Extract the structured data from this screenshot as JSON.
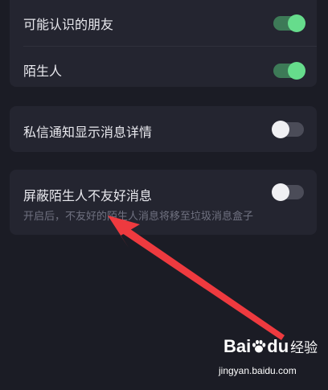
{
  "settings": {
    "group1": {
      "items": [
        {
          "label": "可能认识的朋友",
          "enabled": true
        },
        {
          "label": "陌生人",
          "enabled": true
        }
      ]
    },
    "group2": {
      "items": [
        {
          "label": "私信通知显示消息详情",
          "enabled": false
        }
      ]
    },
    "group3": {
      "items": [
        {
          "label": "屏蔽陌生人不友好消息",
          "description": "开启后，不友好的陌生人消息将移至垃圾消息盒子",
          "enabled": false
        }
      ]
    }
  },
  "colors": {
    "background": "#1b1c25",
    "card": "#242530",
    "toggle_on": "#66dc8c",
    "toggle_off": "#f0f0f3",
    "annotation_arrow": "#ee3a3f"
  },
  "watermark": {
    "logo_text": "Bai",
    "logo_text_2": "du",
    "brand_suffix": "经验",
    "url": "jingyan.baidu.com"
  }
}
